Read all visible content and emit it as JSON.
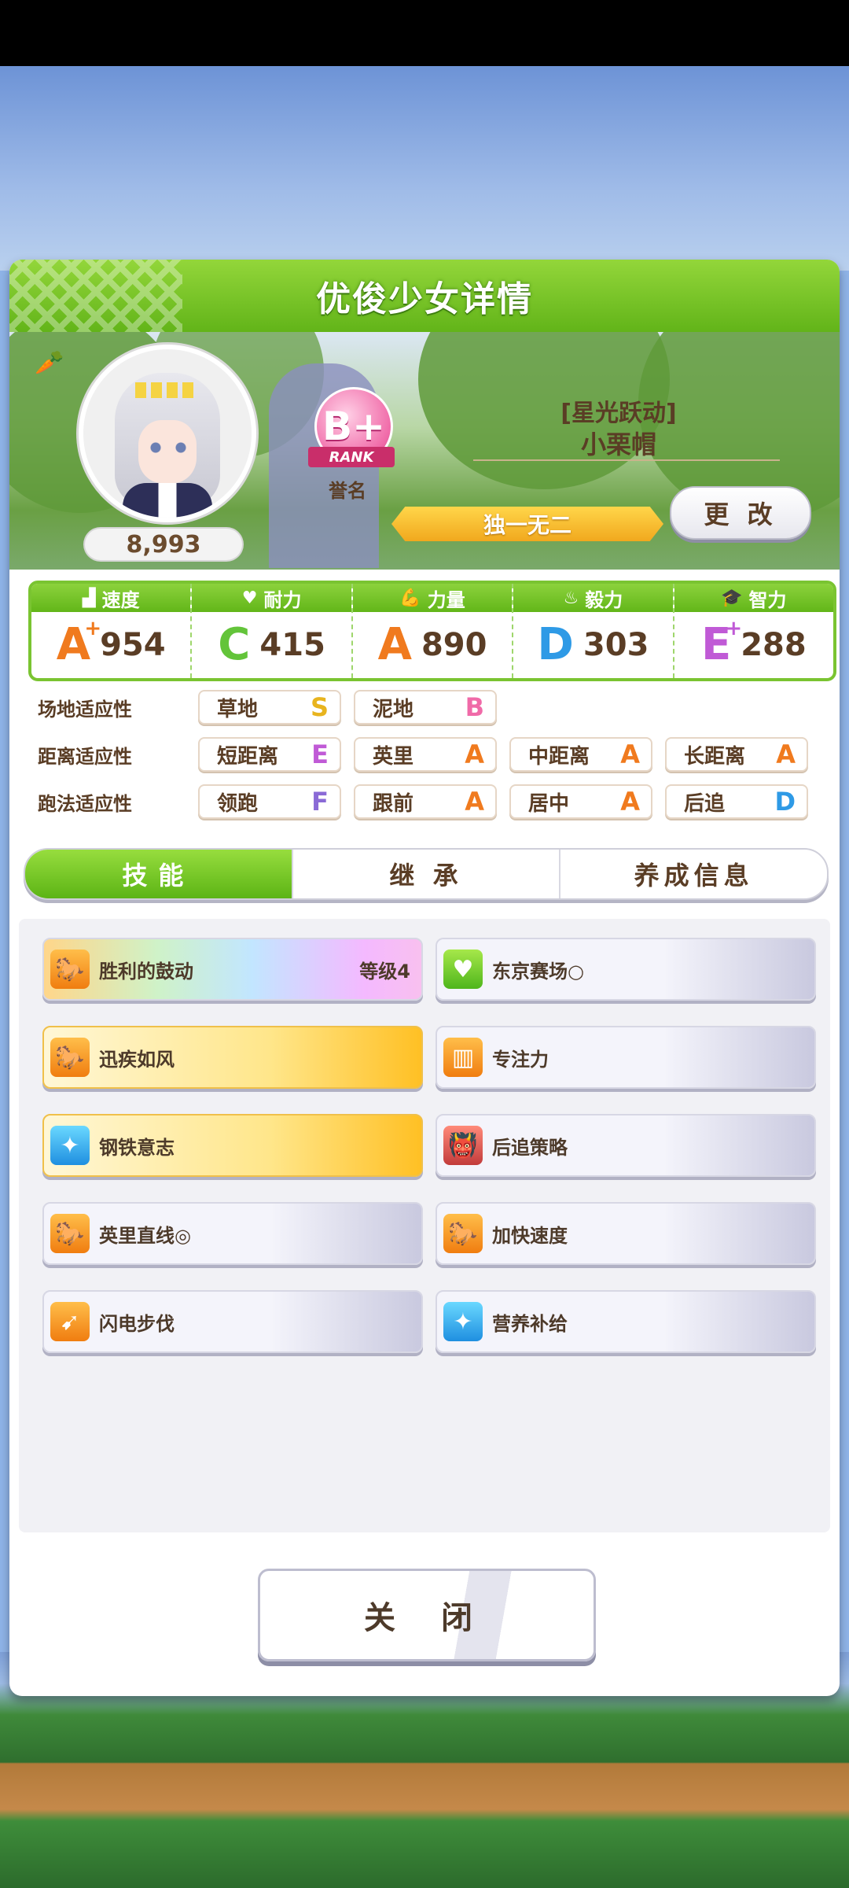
{
  "header": {
    "title": "优俊少女详情"
  },
  "profile": {
    "fans": "8,993",
    "rank": {
      "grade": "B+",
      "ribbon": "RANK",
      "label": "誉名"
    },
    "epithet": "[星光跃动]",
    "name": "小栗帽",
    "title": "独一无二",
    "change_button": "更 改"
  },
  "stats": [
    {
      "name": "速度",
      "icon": "shoe-icon",
      "grade": "A",
      "plus": "+",
      "value": "954",
      "color": "#f07a1e"
    },
    {
      "name": "耐力",
      "icon": "heart-icon",
      "grade": "C",
      "plus": "",
      "value": "415",
      "color": "#63c43a"
    },
    {
      "name": "力量",
      "icon": "muscle-icon",
      "grade": "A",
      "plus": "",
      "value": "890",
      "color": "#f07a1e"
    },
    {
      "name": "毅力",
      "icon": "flame-icon",
      "grade": "D",
      "plus": "",
      "value": "303",
      "color": "#2e9ae6"
    },
    {
      "name": "智力",
      "icon": "graduation-cap-icon",
      "grade": "E",
      "plus": "+",
      "value": "288",
      "color": "#c05ad6"
    }
  ],
  "aptitude": {
    "surface": {
      "label": "场地适应性",
      "items": [
        {
          "name": "草地",
          "grade": "S",
          "color": "#e8b41e"
        },
        {
          "name": "泥地",
          "grade": "B",
          "color": "#f06aa8"
        }
      ]
    },
    "distance": {
      "label": "距离适应性",
      "items": [
        {
          "name": "短距离",
          "grade": "E",
          "color": "#c05ad6"
        },
        {
          "name": "英里",
          "grade": "A",
          "color": "#f07a1e"
        },
        {
          "name": "中距离",
          "grade": "A",
          "color": "#f07a1e"
        },
        {
          "name": "长距离",
          "grade": "A",
          "color": "#f07a1e"
        }
      ]
    },
    "style": {
      "label": "跑法适应性",
      "items": [
        {
          "name": "领跑",
          "grade": "F",
          "color": "#8a6ad6"
        },
        {
          "name": "跟前",
          "grade": "A",
          "color": "#f07a1e"
        },
        {
          "name": "居中",
          "grade": "A",
          "color": "#f07a1e"
        },
        {
          "name": "后追",
          "grade": "D",
          "color": "#2e9ae6"
        }
      ]
    }
  },
  "tabs": [
    "技能",
    "继 承",
    "养成信息"
  ],
  "skills": [
    {
      "name": "胜利的鼓动",
      "level": "等级4",
      "icon": "horse-runner-icon",
      "style": "rainbow",
      "icon_color": "orange"
    },
    {
      "name": "东京赛场○",
      "level": "",
      "icon": "heart-icon",
      "style": "normal",
      "icon_color": "green"
    },
    {
      "name": "迅疾如风",
      "level": "",
      "icon": "horse-runner-icon",
      "style": "gold",
      "icon_color": "orange"
    },
    {
      "name": "专注力",
      "level": "",
      "icon": "gate-icon",
      "style": "normal",
      "icon_color": "orange"
    },
    {
      "name": "钢铁意志",
      "level": "",
      "icon": "sparkle-icon",
      "style": "gold",
      "icon_color": "blue"
    },
    {
      "name": "后追策略",
      "level": "",
      "icon": "demon-icon",
      "style": "normal",
      "icon_color": "red"
    },
    {
      "name": "英里直线◎",
      "level": "",
      "icon": "horse-runner-icon",
      "style": "normal",
      "icon_color": "orange"
    },
    {
      "name": "加快速度",
      "level": "",
      "icon": "horse-runner-icon",
      "style": "normal",
      "icon_color": "orange"
    },
    {
      "name": "闪电步伐",
      "level": "",
      "icon": "arrow-shoe-icon",
      "style": "normal",
      "icon_color": "orange"
    },
    {
      "name": "营养补给",
      "level": "",
      "icon": "sparkle-icon",
      "style": "normal",
      "icon_color": "blue"
    }
  ],
  "close_button": "关 闭"
}
